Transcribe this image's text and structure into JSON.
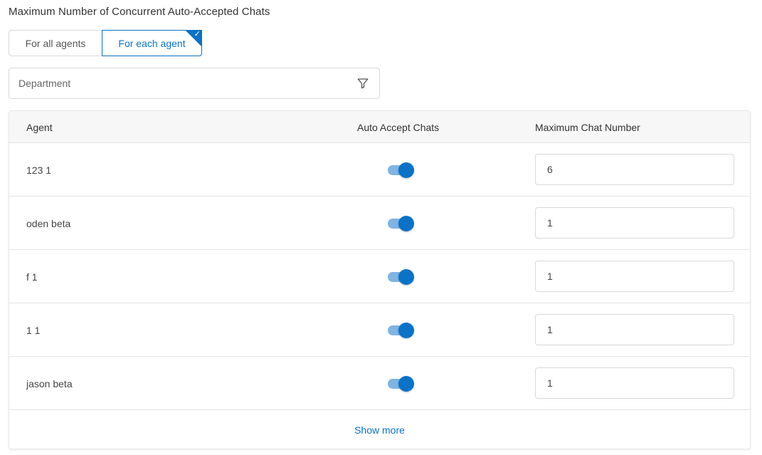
{
  "section": {
    "title": "Maximum Number of Concurrent Auto-Accepted Chats"
  },
  "mode_toggle": {
    "options": [
      {
        "label": "For all agents",
        "selected": false
      },
      {
        "label": "For each agent",
        "selected": true
      }
    ]
  },
  "department_filter": {
    "placeholder": "Department",
    "icon": "filter-icon"
  },
  "table": {
    "columns": {
      "agent": "Agent",
      "auto_accept": "Auto Accept Chats",
      "max_chat": "Maximum Chat Number"
    },
    "rows": [
      {
        "agent": "123 1",
        "auto_accept": true,
        "max_chat": "6"
      },
      {
        "agent": "oden beta",
        "auto_accept": true,
        "max_chat": "1"
      },
      {
        "agent": "f 1",
        "auto_accept": true,
        "max_chat": "1"
      },
      {
        "agent": "1 1",
        "auto_accept": true,
        "max_chat": "1"
      },
      {
        "agent": "jason beta",
        "auto_accept": true,
        "max_chat": "1"
      }
    ],
    "show_more_label": "Show more"
  },
  "colors": {
    "accent": "#0a72c7",
    "toggle_track": "#7fb4e3"
  }
}
